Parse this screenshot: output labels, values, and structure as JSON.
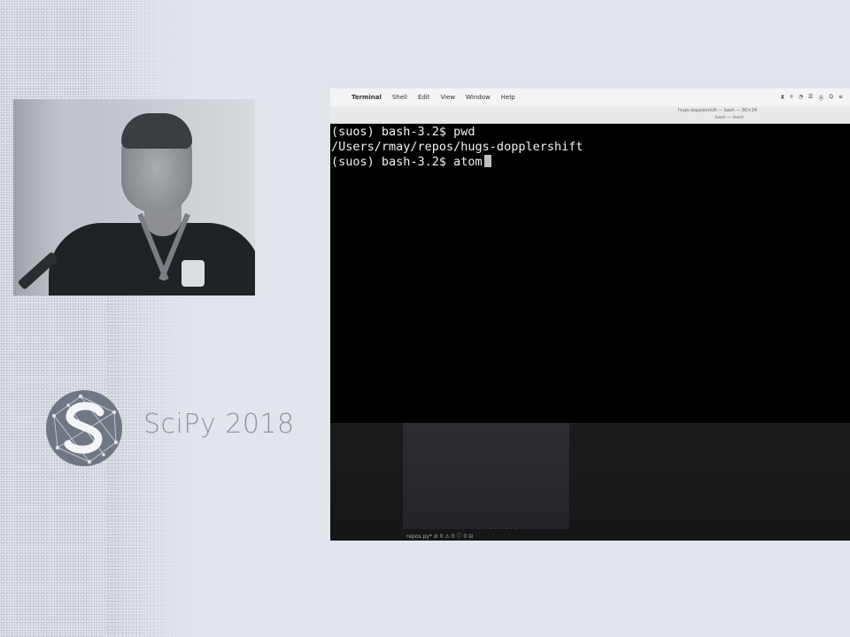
{
  "branding": {
    "conference_name": "SciPy 2018",
    "logo_icon": "scipy-logo-icon",
    "colors": {
      "logo": "#6f7684",
      "text": "#8e95a3",
      "background": "#e2e6ec"
    }
  },
  "speaker_video": {
    "description_icon": "speaker-video-feed"
  },
  "screen": {
    "menubar": {
      "apple_icon": "",
      "menus": [
        "Terminal",
        "Shell",
        "Edit",
        "View",
        "Window",
        "Help"
      ],
      "status_items": [
        "⧗",
        "⌾",
        "◔",
        "☰",
        "Ⓐ",
        "Q",
        "≡"
      ]
    },
    "window": {
      "title": "hugs-dopplershift — bash — 80×24",
      "subtitle": "bash — bash"
    },
    "terminal": {
      "lines": [
        "(suos) bash-3.2$ pwd",
        "/Users/rmay/repos/hugs-dopplershift"
      ],
      "prompt": "(suos) bash-3.2$ ",
      "current_input": "atom"
    },
    "lower_area": {
      "dots": ". . . . . .",
      "status_bar": "repos.py* ⊘ 0 ⚠ 0 ⓘ 0  ⊟"
    }
  }
}
